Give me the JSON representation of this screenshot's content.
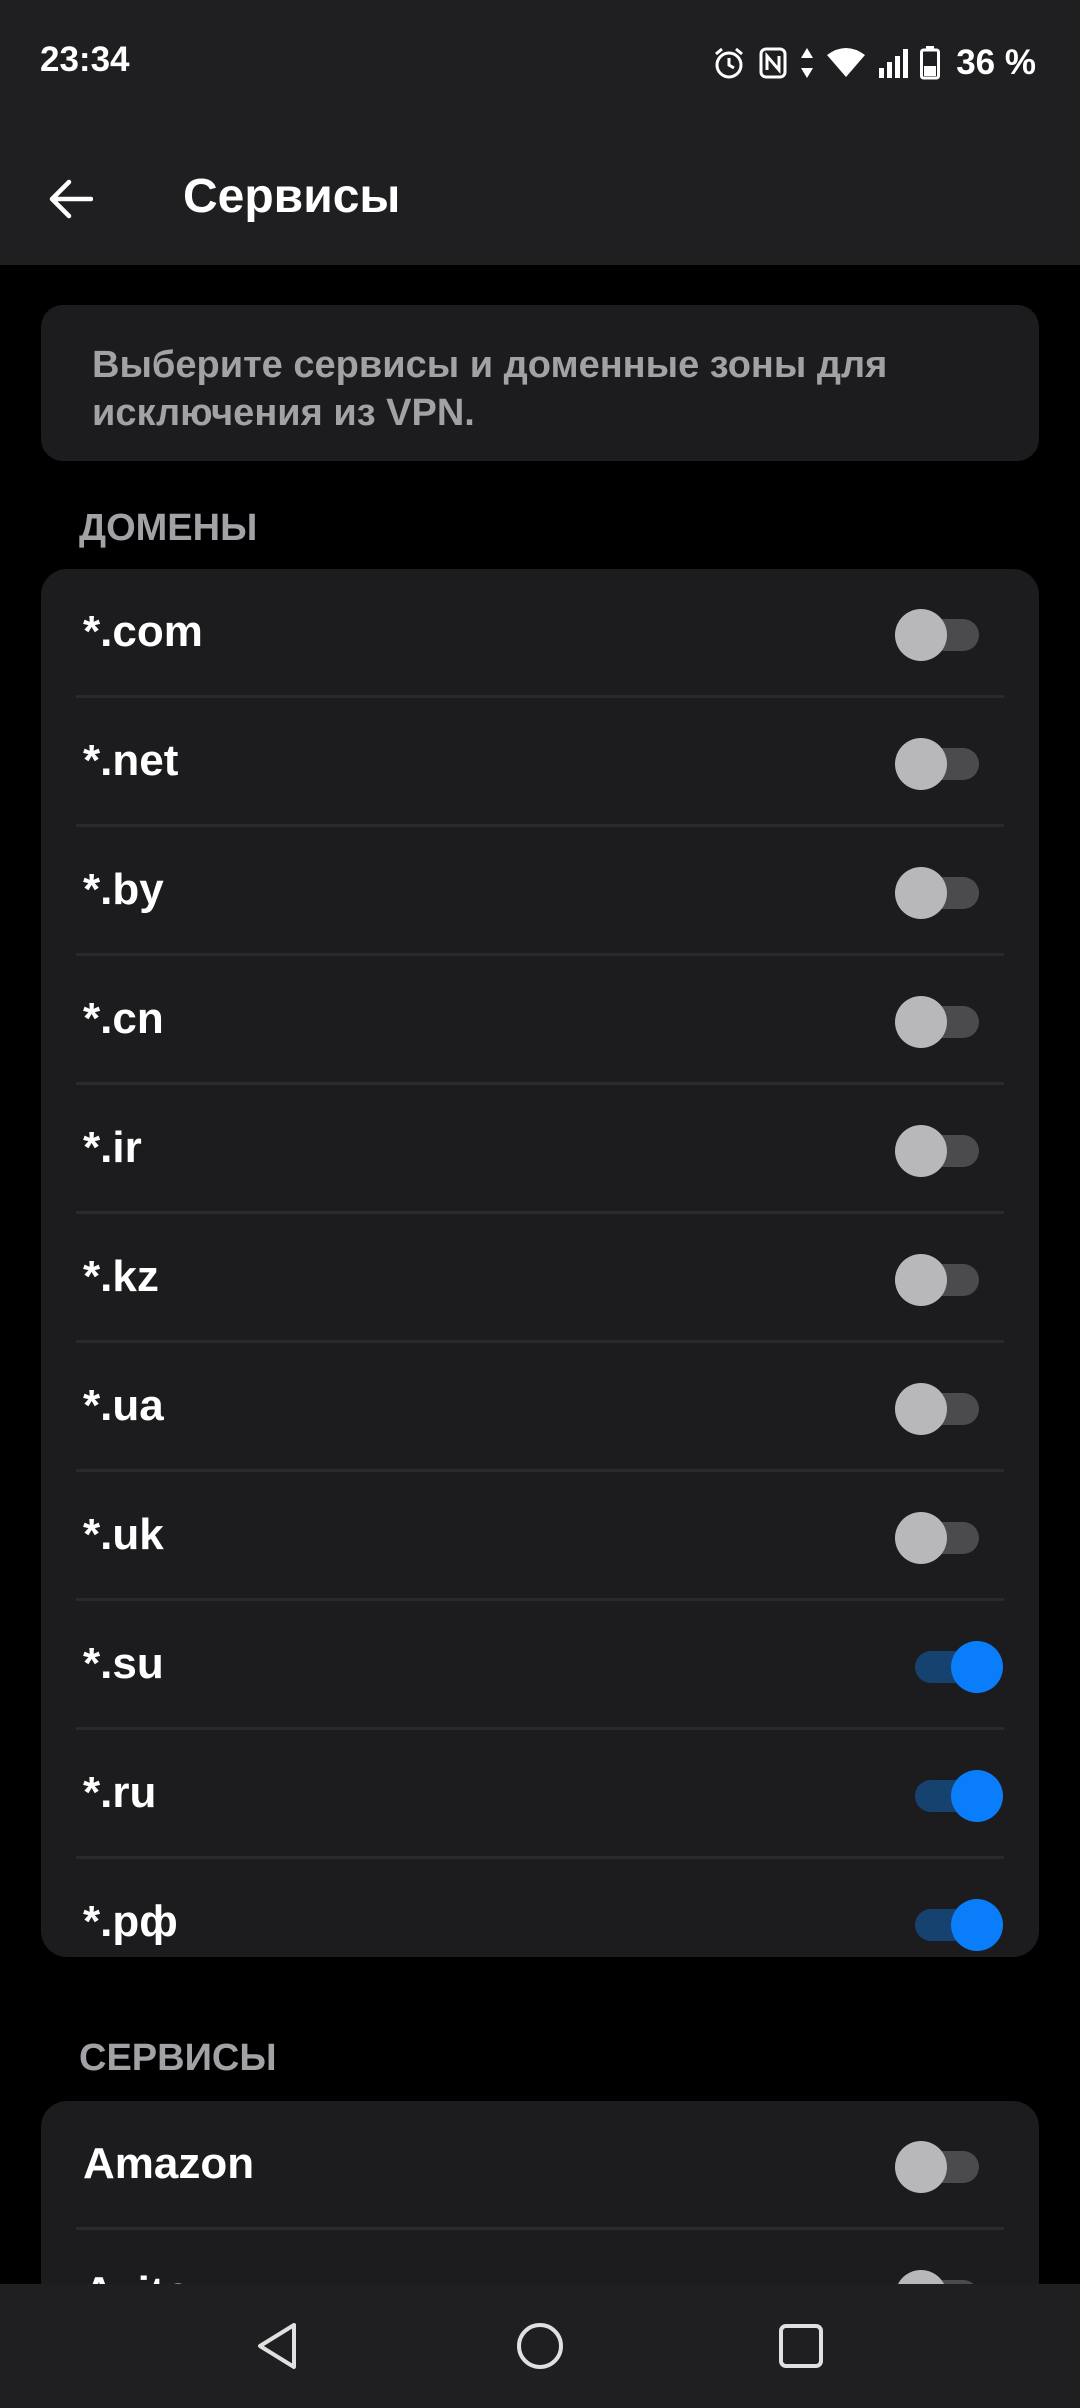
{
  "status_bar": {
    "time": "23:34",
    "battery_percent": "36 %",
    "icons": [
      "alarm-icon",
      "nfc-icon",
      "data-arrows-icon",
      "wifi-icon",
      "signal-icon",
      "battery-icon"
    ]
  },
  "app_bar": {
    "title": "Сервисы",
    "back_icon": "arrow-left-icon"
  },
  "info": {
    "text": "Выберите сервисы и доменные зоны для исключения из VPN."
  },
  "domains": {
    "header": "ДОМЕНЫ",
    "items": [
      {
        "label": "*.com",
        "enabled": false
      },
      {
        "label": "*.net",
        "enabled": false
      },
      {
        "label": "*.by",
        "enabled": false
      },
      {
        "label": "*.cn",
        "enabled": false
      },
      {
        "label": "*.ir",
        "enabled": false
      },
      {
        "label": "*.kz",
        "enabled": false
      },
      {
        "label": "*.ua",
        "enabled": false
      },
      {
        "label": "*.uk",
        "enabled": false
      },
      {
        "label": "*.su",
        "enabled": true
      },
      {
        "label": "*.ru",
        "enabled": true
      },
      {
        "label": "*.рф",
        "enabled": true
      }
    ]
  },
  "services": {
    "header": "СЕРВИСЫ",
    "items": [
      {
        "label": "Amazon",
        "enabled": false
      },
      {
        "label": "Avito",
        "enabled": false
      }
    ]
  },
  "nav_bar": {
    "icons": [
      "back-triangle-icon",
      "home-circle-icon",
      "recents-square-icon"
    ]
  },
  "colors": {
    "accent": "#0a7dfa",
    "card_bg": "#1c1c1e",
    "bar_bg": "#1f1f21",
    "secondary_text": "#a1a1a6"
  }
}
